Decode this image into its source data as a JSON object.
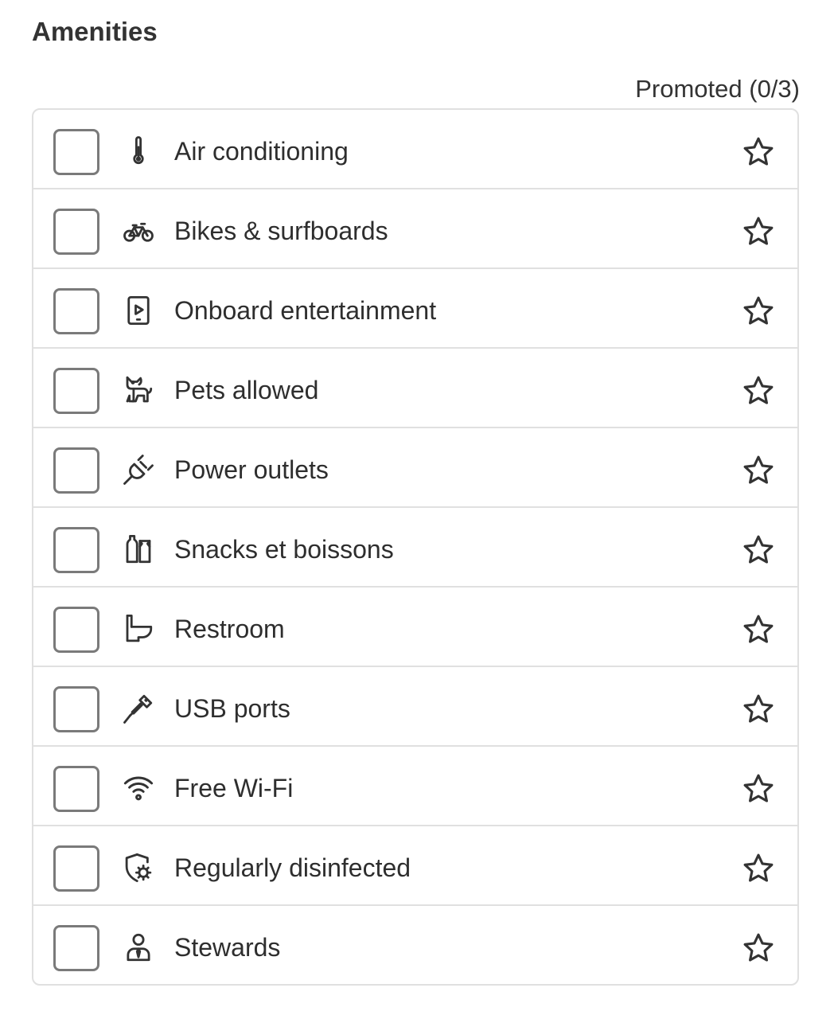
{
  "section": {
    "title": "Amenities",
    "promoted_label": "Promoted (0/3)"
  },
  "amenities": [
    {
      "label": "Air conditioning",
      "icon": "thermometer-icon",
      "checked": false,
      "promoted": false
    },
    {
      "label": "Bikes & surfboards",
      "icon": "bicycle-icon",
      "checked": false,
      "promoted": false
    },
    {
      "label": "Onboard entertainment",
      "icon": "tablet-play-icon",
      "checked": false,
      "promoted": false
    },
    {
      "label": "Pets allowed",
      "icon": "dog-icon",
      "checked": false,
      "promoted": false
    },
    {
      "label": "Power outlets",
      "icon": "plug-icon",
      "checked": false,
      "promoted": false
    },
    {
      "label": "Snacks et boissons",
      "icon": "drinks-snacks-icon",
      "checked": false,
      "promoted": false
    },
    {
      "label": "Restroom",
      "icon": "toilet-icon",
      "checked": false,
      "promoted": false
    },
    {
      "label": "USB ports",
      "icon": "usb-cable-icon",
      "checked": false,
      "promoted": false
    },
    {
      "label": "Free Wi-Fi",
      "icon": "wifi-icon",
      "checked": false,
      "promoted": false
    },
    {
      "label": "Regularly disinfected",
      "icon": "shield-virus-icon",
      "checked": false,
      "promoted": false
    },
    {
      "label": "Stewards",
      "icon": "steward-icon",
      "checked": false,
      "promoted": false
    }
  ],
  "colors": {
    "text": "#2e2e2e",
    "border": "#e0e0e0",
    "checkbox_border": "#7a7a7a",
    "icon": "#333333"
  }
}
